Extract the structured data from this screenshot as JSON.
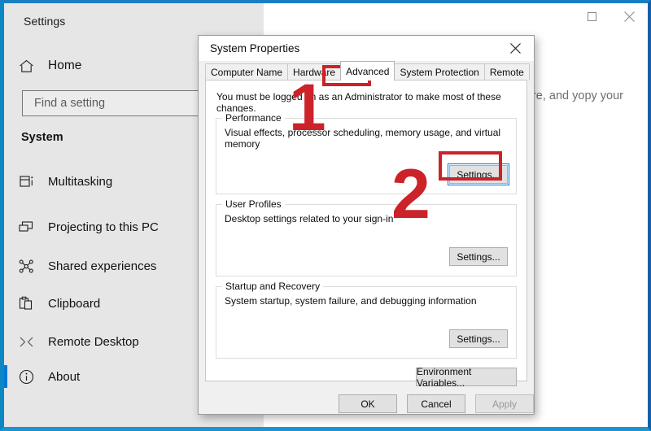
{
  "settings_window": {
    "title": "Settings",
    "window_buttons": [
      {
        "name": "maximize",
        "glyph": "maximize-icon"
      },
      {
        "name": "close",
        "glyph": "close-icon"
      }
    ],
    "home_label": "Home",
    "search_placeholder": "Find a setting",
    "search_value": "",
    "section_heading": "System",
    "nav_items": [
      {
        "label": "Multitasking",
        "icon": "multitasking-icon",
        "selected": false
      },
      {
        "label": "Projecting to this PC",
        "icon": "projecting-icon",
        "selected": false
      },
      {
        "label": "Shared experiences",
        "icon": "shared-experiences-icon",
        "selected": false
      },
      {
        "label": "Clipboard",
        "icon": "clipboard-icon",
        "selected": false
      },
      {
        "label": "Remote Desktop",
        "icon": "remote-desktop-icon",
        "selected": false
      },
      {
        "label": "About",
        "icon": "about-info-icon",
        "selected": true
      }
    ],
    "right_pane_partial_text": "re, and yopy your"
  },
  "dialog": {
    "title": "System Properties",
    "close_label": "✕",
    "tabs": [
      {
        "label": "Computer Name",
        "active": false
      },
      {
        "label": "Hardware",
        "active": false
      },
      {
        "label": "Advanced",
        "active": true
      },
      {
        "label": "System Protection",
        "active": false
      },
      {
        "label": "Remote",
        "active": false
      }
    ],
    "admin_note": "You must be logged on as an Administrator to make most of these changes.",
    "groups": [
      {
        "legend": "Performance",
        "description": "Visual effects, processor scheduling, memory usage, and virtual memory",
        "button_label": "Settings...",
        "button_focused": true
      },
      {
        "legend": "User Profiles",
        "description": "Desktop settings related to your sign-in",
        "button_label": "Settings...",
        "button_focused": false
      },
      {
        "legend": "Startup and Recovery",
        "description": "System startup, system failure, and debugging information",
        "button_label": "Settings...",
        "button_focused": false
      }
    ],
    "env_button_label": "Environment Variables...",
    "footer_buttons": [
      {
        "label": "OK",
        "disabled": false
      },
      {
        "label": "Cancel",
        "disabled": false
      },
      {
        "label": "Apply",
        "disabled": true
      }
    ]
  },
  "annotations": {
    "step_one": "1",
    "step_two": "2",
    "color": "#cc2229"
  }
}
